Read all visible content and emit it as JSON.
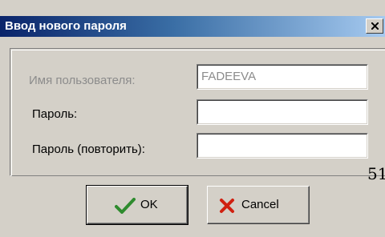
{
  "window": {
    "title": "Ввод нового пароля",
    "close_icon": "close-icon"
  },
  "form": {
    "username_label": "Имя пользователя:",
    "username_value": "FADEEVA",
    "password_label": "Пароль:",
    "password_value": "",
    "password_repeat_label": "Пароль (повторить):",
    "password_repeat_value": ""
  },
  "buttons": {
    "ok_label": "OK",
    "ok_icon": "checkmark-icon",
    "cancel_label": "Cancel",
    "cancel_icon": "cross-icon"
  },
  "background_fragment": "51",
  "colors": {
    "title_start": "#0a246a",
    "title_end": "#a6caf0",
    "dialog_face": "#d4d0c8",
    "disabled_text": "#8c8c8c",
    "ok_check": "#2e8b2e",
    "cancel_x": "#d02010"
  }
}
